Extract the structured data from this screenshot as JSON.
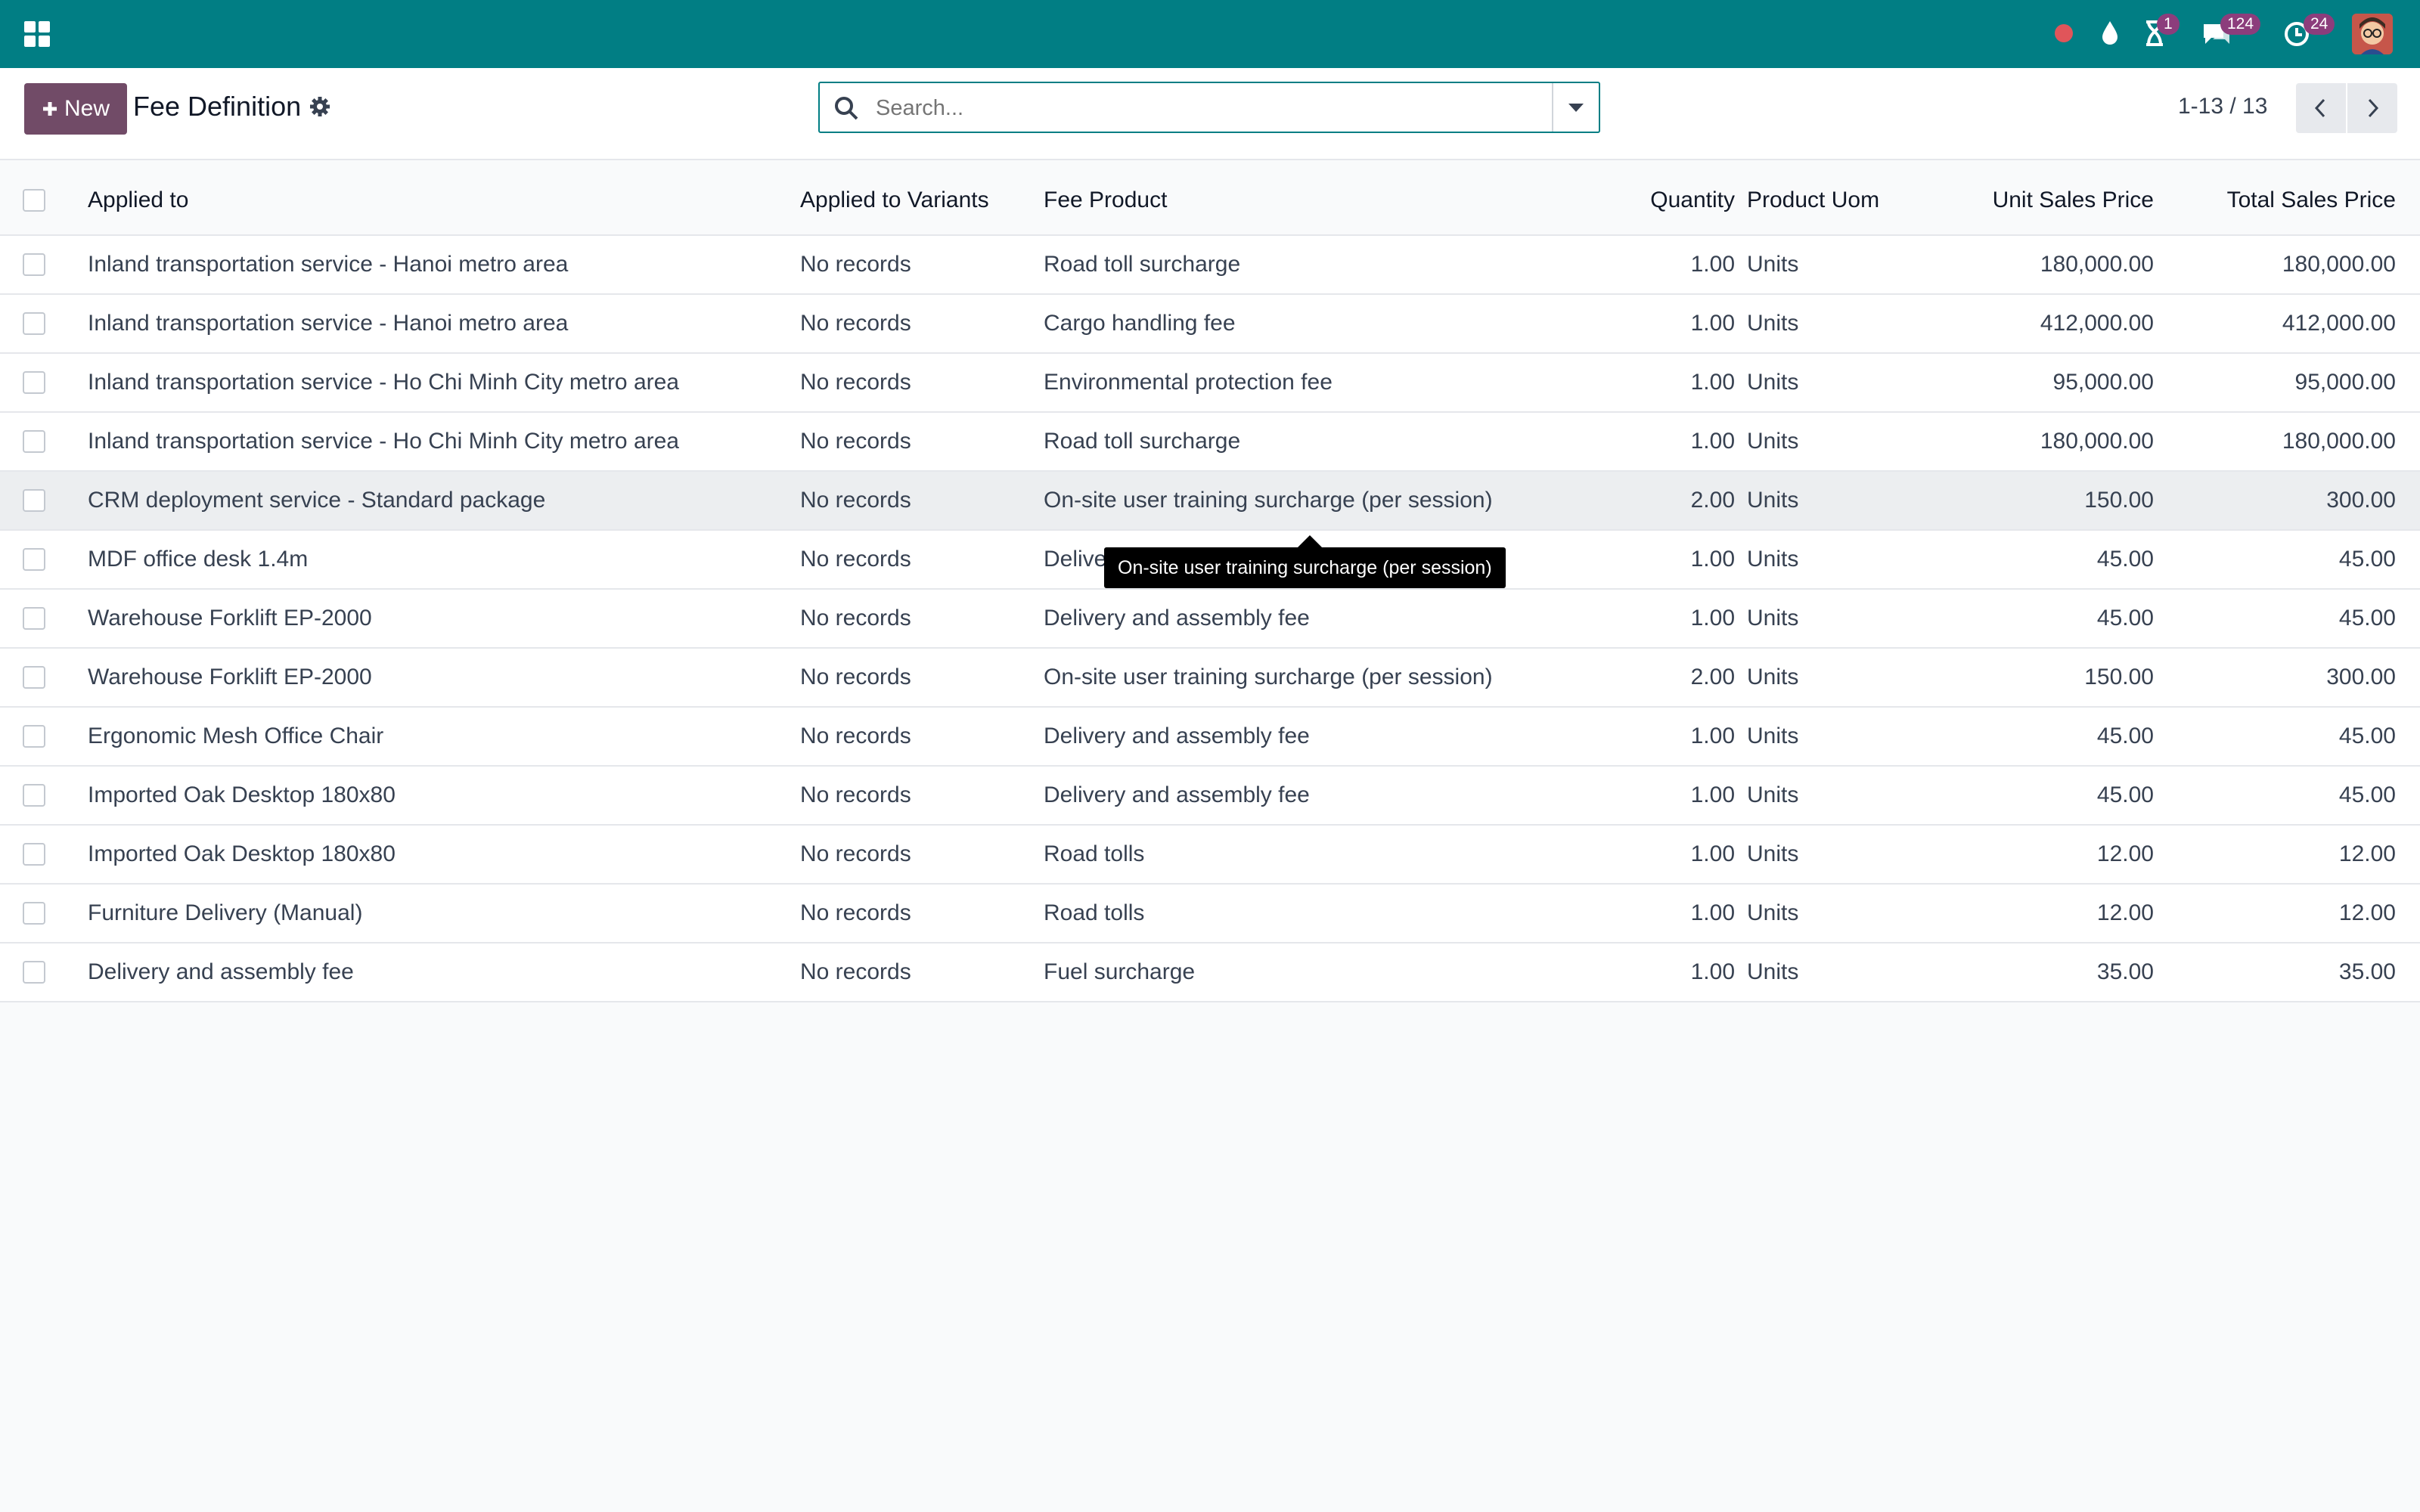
{
  "topbar": {
    "badges": {
      "activities": "1",
      "messages": "124",
      "clock": "24"
    }
  },
  "control": {
    "new_label": "New",
    "title": "Fee Definition",
    "search_placeholder": "Search...",
    "pager": "1-13 / 13"
  },
  "columns": {
    "applied_to": "Applied to",
    "variants": "Applied to Variants",
    "fee_product": "Fee Product",
    "quantity": "Quantity",
    "uom": "Product Uom",
    "unit_price": "Unit Sales Price",
    "total_price": "Total Sales Price"
  },
  "rows": [
    {
      "applied_to": "Inland transportation service - Hanoi metro area",
      "variants": "No records",
      "fee": "Road toll surcharge",
      "qty": "1.00",
      "uom": "Units",
      "unit": "180,000.00",
      "total": "180,000.00"
    },
    {
      "applied_to": "Inland transportation service - Hanoi metro area",
      "variants": "No records",
      "fee": "Cargo handling fee",
      "qty": "1.00",
      "uom": "Units",
      "unit": "412,000.00",
      "total": "412,000.00"
    },
    {
      "applied_to": "Inland transportation service - Ho Chi Minh City metro area",
      "variants": "No records",
      "fee": "Environmental protection fee",
      "qty": "1.00",
      "uom": "Units",
      "unit": "95,000.00",
      "total": "95,000.00"
    },
    {
      "applied_to": "Inland transportation service - Ho Chi Minh City metro area",
      "variants": "No records",
      "fee": "Road toll surcharge",
      "qty": "1.00",
      "uom": "Units",
      "unit": "180,000.00",
      "total": "180,000.00"
    },
    {
      "applied_to": "CRM deployment service - Standard package",
      "variants": "No records",
      "fee": "On-site user training surcharge (per session)",
      "qty": "2.00",
      "uom": "Units",
      "unit": "150.00",
      "total": "300.00"
    },
    {
      "applied_to": "MDF office desk 1.4m",
      "variants": "No records",
      "fee": "Delive",
      "qty": "1.00",
      "uom": "Units",
      "unit": "45.00",
      "total": "45.00"
    },
    {
      "applied_to": "Warehouse Forklift EP-2000",
      "variants": "No records",
      "fee": "Delivery and assembly fee",
      "qty": "1.00",
      "uom": "Units",
      "unit": "45.00",
      "total": "45.00"
    },
    {
      "applied_to": "Warehouse Forklift EP-2000",
      "variants": "No records",
      "fee": "On-site user training surcharge (per session)",
      "qty": "2.00",
      "uom": "Units",
      "unit": "150.00",
      "total": "300.00"
    },
    {
      "applied_to": "Ergonomic Mesh Office Chair",
      "variants": "No records",
      "fee": "Delivery and assembly fee",
      "qty": "1.00",
      "uom": "Units",
      "unit": "45.00",
      "total": "45.00"
    },
    {
      "applied_to": "Imported Oak Desktop 180x80",
      "variants": "No records",
      "fee": "Delivery and assembly fee",
      "qty": "1.00",
      "uom": "Units",
      "unit": "45.00",
      "total": "45.00"
    },
    {
      "applied_to": "Imported Oak Desktop 180x80",
      "variants": "No records",
      "fee": "Road tolls",
      "qty": "1.00",
      "uom": "Units",
      "unit": "12.00",
      "total": "12.00"
    },
    {
      "applied_to": "Furniture Delivery (Manual)",
      "variants": "No records",
      "fee": "Road tolls",
      "qty": "1.00",
      "uom": "Units",
      "unit": "12.00",
      "total": "12.00"
    },
    {
      "applied_to": "Delivery and assembly fee",
      "variants": "No records",
      "fee": "Fuel surcharge",
      "qty": "1.00",
      "uom": "Units",
      "unit": "35.00",
      "total": "35.00"
    }
  ],
  "tooltip": "On-site user training surcharge (per session)",
  "colors": {
    "topbar": "#017e84",
    "primary": "#714b67",
    "badge": "#8c3d7c"
  }
}
